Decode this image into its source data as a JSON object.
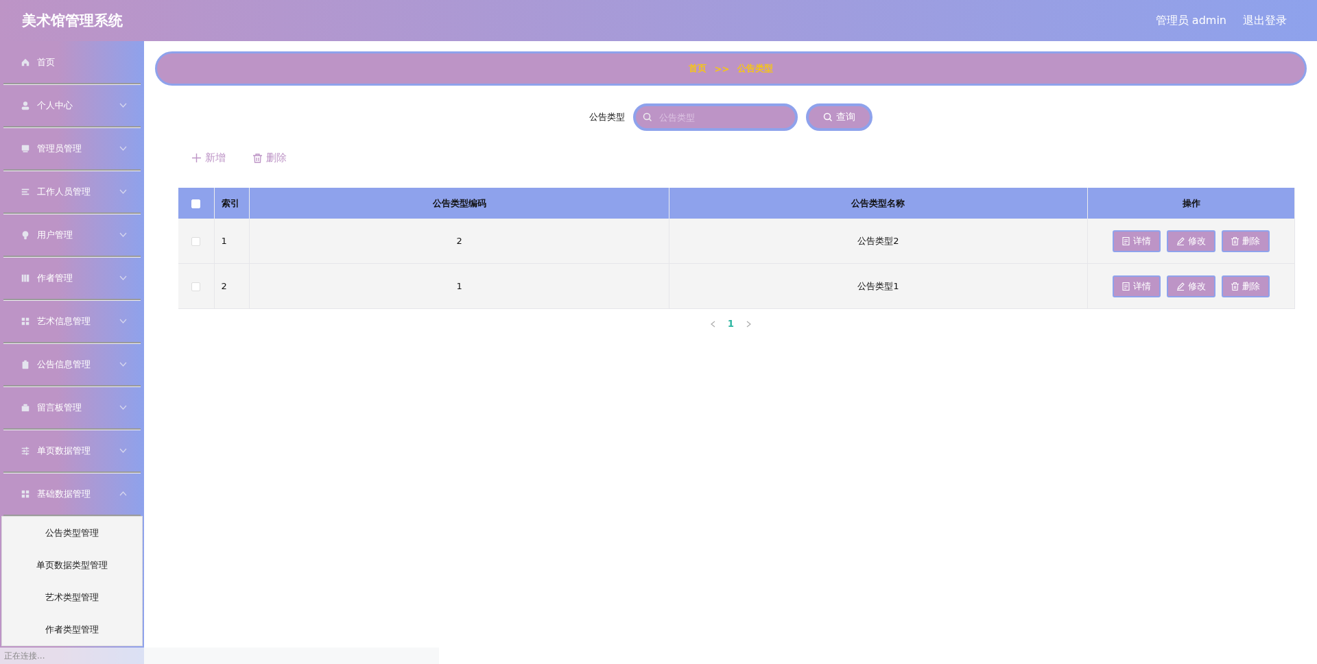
{
  "header": {
    "title": "美术馆管理系统",
    "user": "管理员 admin",
    "logout": "退出登录"
  },
  "sidebar": {
    "items": [
      {
        "label": "首页",
        "kind": "link"
      },
      {
        "label": "个人中心",
        "kind": "menu",
        "expanded": false
      },
      {
        "label": "管理员管理",
        "kind": "menu",
        "expanded": false
      },
      {
        "label": "工作人员管理",
        "kind": "menu",
        "expanded": false
      },
      {
        "label": "用户管理",
        "kind": "menu",
        "expanded": false
      },
      {
        "label": "作者管理",
        "kind": "menu",
        "expanded": false
      },
      {
        "label": "艺术信息管理",
        "kind": "menu",
        "expanded": false
      },
      {
        "label": "公告信息管理",
        "kind": "menu",
        "expanded": false
      },
      {
        "label": "留言板管理",
        "kind": "menu",
        "expanded": false
      },
      {
        "label": "单页数据管理",
        "kind": "menu",
        "expanded": false
      },
      {
        "label": "基础数据管理",
        "kind": "menu",
        "expanded": true,
        "children": [
          {
            "label": "公告类型管理"
          },
          {
            "label": "单页数据类型管理"
          },
          {
            "label": "艺术类型管理"
          },
          {
            "label": "作者类型管理"
          }
        ]
      }
    ]
  },
  "breadcrumb": {
    "items": [
      "首页",
      "公告类型"
    ],
    "separator": ">>"
  },
  "search": {
    "label": "公告类型",
    "placeholder": "公告类型",
    "button": "查询"
  },
  "actions": [
    "新增",
    "删除"
  ],
  "table": {
    "header_checked": false,
    "columns": [
      "索引",
      "公告类型编码",
      "公告类型名称",
      "操作"
    ],
    "rows": [
      {
        "checked": false,
        "index": "1",
        "code": "2",
        "name": "公告类型2",
        "buttons": [
          "详情",
          "修改",
          "删除"
        ]
      },
      {
        "checked": false,
        "index": "2",
        "code": "1",
        "name": "公告类型1",
        "buttons": [
          "详情",
          "修改",
          "删除"
        ]
      }
    ]
  },
  "pagination": {
    "pages": [
      {
        "label": "1",
        "selected": true
      }
    ]
  },
  "status_text": "正在连接..."
}
